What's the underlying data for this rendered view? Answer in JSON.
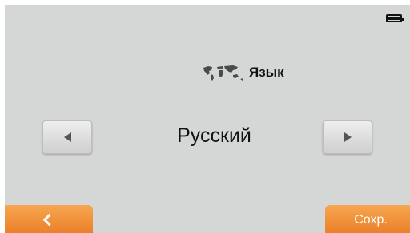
{
  "header": {
    "title": "Язык",
    "title_icon": "world-map-icon",
    "battery_icon": "battery-icon"
  },
  "language_selector": {
    "current": "Русский",
    "prev_icon": "triangle-left-icon",
    "next_icon": "triangle-right-icon"
  },
  "footer": {
    "back_icon": "chevron-left-icon",
    "save_label": "Сохр."
  },
  "colors": {
    "background": "#d5d6d6",
    "accent_orange": "#f08a33",
    "button_gray": "#e0e0e0"
  }
}
